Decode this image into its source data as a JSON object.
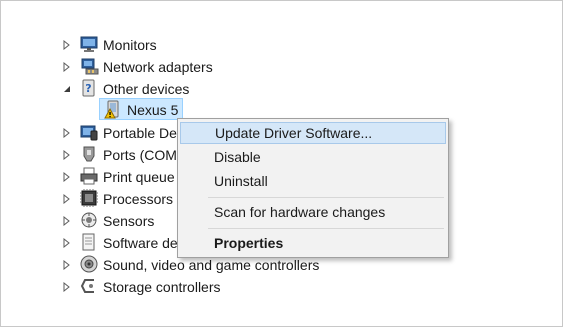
{
  "tree": {
    "items": [
      {
        "label": "Monitors",
        "icon": "monitor-icon"
      },
      {
        "label": "Network adapters",
        "icon": "network-adapter-icon"
      },
      {
        "label": "Other devices",
        "icon": "unknown-device-icon",
        "expanded": true
      },
      {
        "label": "Nexus 5",
        "icon": "warning-device-icon",
        "selected": true
      },
      {
        "label": "Portable De",
        "icon": "portable-device-icon"
      },
      {
        "label": "Ports (COM",
        "icon": "port-icon"
      },
      {
        "label": "Print queue",
        "icon": "printer-icon"
      },
      {
        "label": "Processors",
        "icon": "processor-icon"
      },
      {
        "label": "Sensors",
        "icon": "sensor-icon"
      },
      {
        "label": "Software de",
        "icon": "software-device-icon"
      },
      {
        "label": "Sound, video and game controllers",
        "icon": "speaker-icon"
      },
      {
        "label": "Storage controllers",
        "icon": "storage-controller-icon"
      }
    ]
  },
  "context_menu": {
    "items": [
      {
        "label": "Update Driver Software...",
        "highlighted": true
      },
      {
        "label": "Disable"
      },
      {
        "label": "Uninstall"
      },
      {
        "label": "Scan for hardware changes"
      },
      {
        "label": "Properties",
        "bold": true
      }
    ]
  },
  "colors": {
    "selection": "#cce8ff",
    "menu_highlight": "#d5e7f8",
    "menu_background": "#f2f2f2"
  }
}
